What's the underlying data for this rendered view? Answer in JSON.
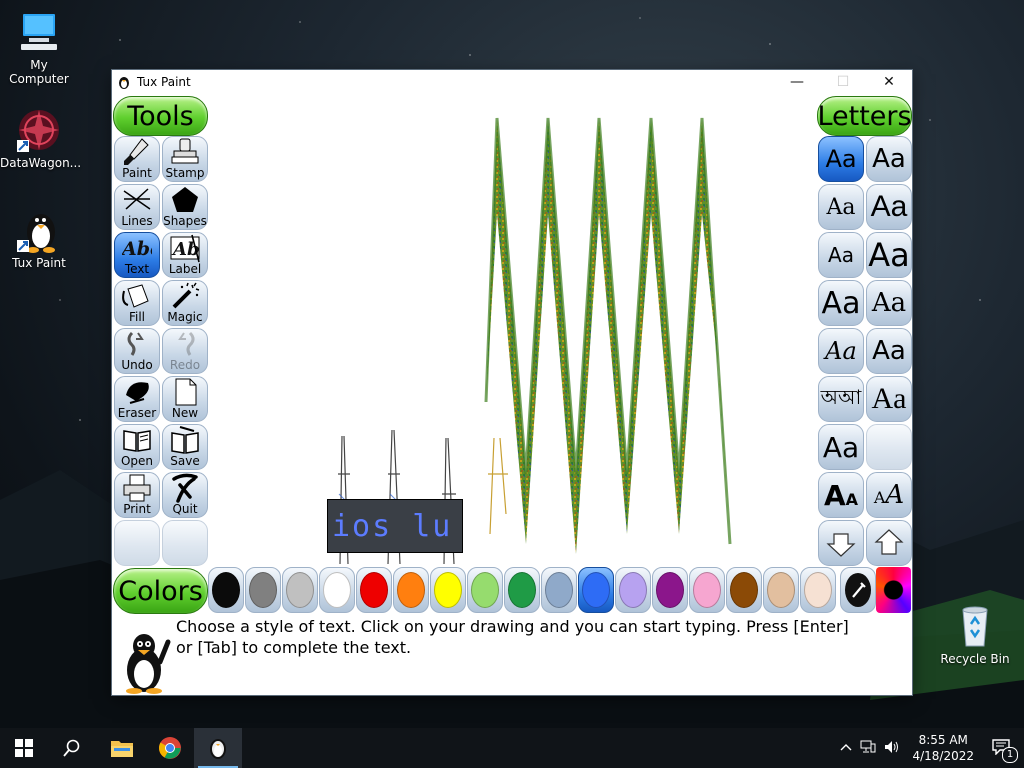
{
  "desktop": {
    "icons": [
      {
        "label": "My Computer"
      },
      {
        "label": "DataWagon..."
      },
      {
        "label": "Tux Paint"
      },
      {
        "label": "Recycle Bin"
      }
    ]
  },
  "window": {
    "title": "Tux Paint",
    "controls": {
      "minimize": "—",
      "maximize": "☐",
      "close": "✕"
    }
  },
  "tools": {
    "header": "Tools",
    "items": [
      {
        "label": "Paint"
      },
      {
        "label": "Stamp"
      },
      {
        "label": "Lines"
      },
      {
        "label": "Shapes"
      },
      {
        "label": "Text",
        "active": true
      },
      {
        "label": "Label"
      },
      {
        "label": "Fill"
      },
      {
        "label": "Magic"
      },
      {
        "label": "Undo"
      },
      {
        "label": "Redo",
        "disabled": true
      },
      {
        "label": "Eraser"
      },
      {
        "label": "New"
      },
      {
        "label": "Open"
      },
      {
        "label": "Save"
      },
      {
        "label": "Print"
      },
      {
        "label": "Quit"
      }
    ]
  },
  "letters": {
    "header": "Letters",
    "sample": "Aa",
    "alt_sample": "অআ"
  },
  "canvas": {
    "text_entry": "ios lu"
  },
  "colors": {
    "header": "Colors",
    "swatches": [
      "#0b0b0b",
      "#808080",
      "#c0c0c0",
      "#ffffff",
      "#ee0000",
      "#ff7f0f",
      "#ffff00",
      "#96dc6e",
      "#1f9b46",
      "#8fa9c9",
      "#2e6cf5",
      "#b7a2f0",
      "#8b168b",
      "#f6a6d0",
      "#8b4a06",
      "#e2bf9f",
      "#f6e1d3"
    ],
    "active_index": 10
  },
  "tip": {
    "message": "Choose a style of text. Click on your drawing and you can start typing. Press [Enter] or [Tab] to complete the text."
  },
  "taskbar": {
    "time": "8:55 AM",
    "date": "4/18/2022",
    "notification_count": "1"
  }
}
